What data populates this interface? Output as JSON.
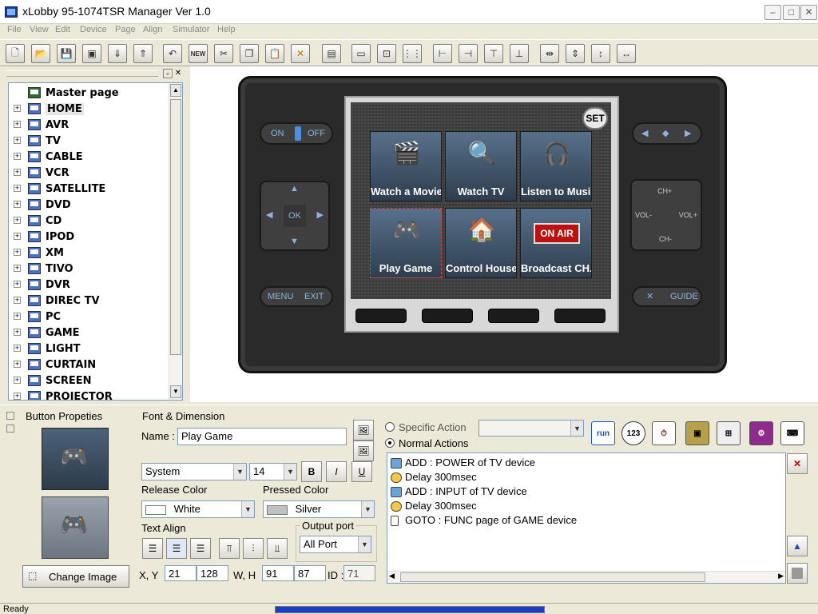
{
  "window": {
    "title": "xLobby 95-1074TSR Manager Ver 1.0"
  },
  "menu": [
    "File",
    "View",
    "Edit",
    "Device",
    "Page",
    "Align",
    "Simulator",
    "Help"
  ],
  "tree": {
    "items": [
      {
        "label": "Master page",
        "expandable": false
      },
      {
        "label": "HOME",
        "expandable": true
      },
      {
        "label": "AVR",
        "expandable": true
      },
      {
        "label": "TV",
        "expandable": true
      },
      {
        "label": "CABLE",
        "expandable": true
      },
      {
        "label": "VCR",
        "expandable": true
      },
      {
        "label": "SATELLITE",
        "expandable": true
      },
      {
        "label": "DVD",
        "expandable": true
      },
      {
        "label": "CD",
        "expandable": true
      },
      {
        "label": "IPOD",
        "expandable": true
      },
      {
        "label": "XM",
        "expandable": true
      },
      {
        "label": "TIVO",
        "expandable": true
      },
      {
        "label": "DVR",
        "expandable": true
      },
      {
        "label": "DIREC TV",
        "expandable": true
      },
      {
        "label": "PC",
        "expandable": true
      },
      {
        "label": "GAME",
        "expandable": true
      },
      {
        "label": "LIGHT",
        "expandable": true
      },
      {
        "label": "CURTAIN",
        "expandable": true
      },
      {
        "label": "SCREEN",
        "expandable": true
      },
      {
        "label": "PROJECTOR",
        "expandable": true
      }
    ]
  },
  "remote": {
    "set_label": "SET",
    "on_label": "ON",
    "off_label": "OFF",
    "ok_label": "OK",
    "menu_label": "MENU",
    "exit_label": "EXIT",
    "guide_label": "GUIDE",
    "ch_up": "CH+",
    "ch_down": "CH-",
    "vol_down": "VOL-",
    "vol_up": "VOL+",
    "tiles": [
      {
        "label": "Watch a Movie",
        "icon": "film-reel-icon"
      },
      {
        "label": "Watch TV",
        "icon": "tv-search-icon"
      },
      {
        "label": "Listen to Music",
        "icon": "headphones-icon"
      },
      {
        "label": "Play Game",
        "icon": "game-console-icon"
      },
      {
        "label": "Control House",
        "icon": "house-icon"
      },
      {
        "label": "Broadcast CH.",
        "icon": "on-air-icon",
        "badge": "ON AIR"
      }
    ]
  },
  "properties": {
    "button_props_label": "Button Propeties",
    "change_image_label": "Change Image",
    "font_group_label": "Font & Dimension",
    "name_label": "Name :",
    "name_value": "Play Game",
    "font_value": "System",
    "size_value": "14",
    "bold_label": "B",
    "italic_label": "I",
    "underline_label": "U",
    "release_color_label": "Release Color",
    "release_color_value": "White",
    "release_color_hex": "#ffffff",
    "pressed_color_label": "Pressed Color",
    "pressed_color_value": "Silver",
    "pressed_color_hex": "#c0c0c0",
    "text_align_label": "Text Align",
    "output_port_label": "Output port",
    "output_port_value": "All Port",
    "xy_label": "X, Y",
    "x_value": "21",
    "y_value": "128",
    "wh_label": "W, H",
    "w_value": "91",
    "h_value": "87",
    "id_label": "ID :",
    "id_value": "71"
  },
  "actions": {
    "specific_label": "Specific Action",
    "normal_label": "Normal Actions",
    "selected": "normal",
    "icons": [
      "run-icon",
      "numpad-123-icon",
      "run-timer-icon",
      "device-select-icon",
      "tree-icon",
      "gear-icon",
      "keyboard-icon"
    ],
    "list": [
      {
        "type": "device",
        "text": "ADD : POWER of TV device"
      },
      {
        "type": "delay",
        "text": "Delay 300msec"
      },
      {
        "type": "device",
        "text": "ADD : INPUT of TV device"
      },
      {
        "type": "delay",
        "text": "Delay 300msec"
      },
      {
        "type": "goto",
        "text": "GOTO : FUNC page of GAME device"
      }
    ]
  },
  "status": {
    "text": "Ready",
    "progress": 1.0
  }
}
